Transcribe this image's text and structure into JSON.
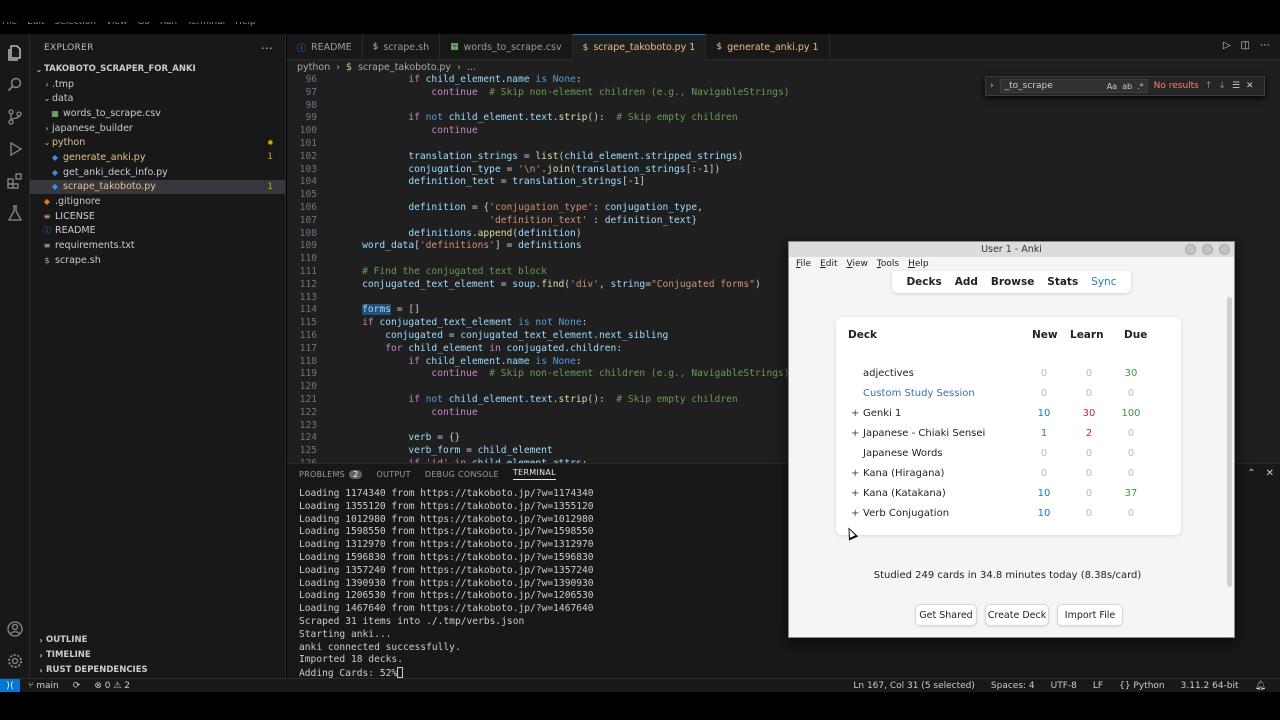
{
  "menubar": [
    "File",
    "Edit",
    "Selection",
    "View",
    "Go",
    "Run",
    "Terminal",
    "Help"
  ],
  "explorer": {
    "title": "EXPLORER",
    "root": "TAKOBOTO_SCRAPER_FOR_ANKI",
    "items": [
      {
        "label": ".tmp",
        "type": "folder",
        "indent": 1,
        "open": false
      },
      {
        "label": "data",
        "type": "folder",
        "indent": 1,
        "open": true
      },
      {
        "label": "words_to_scrape.csv",
        "type": "csv",
        "indent": 2
      },
      {
        "label": "japanese_builder",
        "type": "folder",
        "indent": 1,
        "open": false
      },
      {
        "label": "python",
        "type": "folder",
        "indent": 1,
        "open": true,
        "modified": true
      },
      {
        "label": "generate_anki.py",
        "type": "py",
        "indent": 2,
        "badge": "1",
        "modified": true
      },
      {
        "label": "get_anki_deck_info.py",
        "type": "py",
        "indent": 2
      },
      {
        "label": "scrape_takoboto.py",
        "type": "py",
        "indent": 2,
        "badge": "1",
        "modified": true,
        "selected": true
      },
      {
        "label": ".gitignore",
        "type": "git",
        "indent": 1
      },
      {
        "label": "LICENSE",
        "type": "license",
        "indent": 1
      },
      {
        "label": "README",
        "type": "info",
        "indent": 1
      },
      {
        "label": "requirements.txt",
        "type": "txt",
        "indent": 1
      },
      {
        "label": "scrape.sh",
        "type": "sh",
        "indent": 1
      }
    ],
    "sections": [
      "OUTLINE",
      "TIMELINE",
      "RUST DEPENDENCIES"
    ]
  },
  "tabs": [
    {
      "label": "README",
      "icon": "info-icon"
    },
    {
      "label": "scrape.sh",
      "icon": "dollar-icon"
    },
    {
      "label": "words_to_scrape.csv",
      "icon": "table-icon"
    },
    {
      "label": "scrape_takoboto.py 1",
      "icon": "python-icon",
      "active": true
    },
    {
      "label": "generate_anki.py 1",
      "icon": "python-icon"
    }
  ],
  "breadcrumb": [
    "python",
    "scrape_takoboto.py",
    "..."
  ],
  "find": {
    "value": "_to_scrape",
    "result": "No results"
  },
  "code_lines": [
    {
      "n": "96",
      "html": "            <span class='kc'>if</span> <span class='v'>child_element</span>.<span class='v'>name</span> <span class='k'>is</span> <span class='k'>None</span>:"
    },
    {
      "n": "97",
      "html": "                <span class='kc'>continue</span>  <span class='c'># Skip non-element children (e.g., NavigableStrings)</span>"
    },
    {
      "n": "98",
      "html": ""
    },
    {
      "n": "99",
      "html": "            <span class='kc'>if</span> <span class='k'>not</span> <span class='v'>child_element</span>.<span class='v'>text</span>.<span class='f'>strip</span>():  <span class='c'># Skip empty children</span>"
    },
    {
      "n": "100",
      "html": "                <span class='kc'>continue</span>"
    },
    {
      "n": "101",
      "html": ""
    },
    {
      "n": "102",
      "html": "            <span class='v'>translation_strings</span> = <span class='f'>list</span>(<span class='v'>child_element</span>.<span class='v'>stripped_strings</span>)"
    },
    {
      "n": "103",
      "html": "            <span class='v'>conjugation_type</span> = <span class='s'>'\\n'</span>.<span class='f'>join</span>(<span class='v'>translation_strings</span>[:-1])"
    },
    {
      "n": "104",
      "html": "            <span class='v'>definition_text</span> = <span class='v'>translation_strings</span>[-1]"
    },
    {
      "n": "105",
      "html": ""
    },
    {
      "n": "106",
      "html": "            <span class='v'>definition</span> = {<span class='s'>'conjugation_type'</span>: <span class='v'>conjugation_type</span>,"
    },
    {
      "n": "107",
      "html": "                          <span class='s'>'definition_text'</span> : <span class='v'>definition_text</span>}"
    },
    {
      "n": "108",
      "html": "            <span class='v'>definitions</span>.<span class='f'>append</span>(<span class='v'>definition</span>)"
    },
    {
      "n": "109",
      "html": "    <span class='v'>word_data</span>[<span class='s'>'definitions'</span>] = <span class='v'>definitions</span>"
    },
    {
      "n": "110",
      "html": ""
    },
    {
      "n": "111",
      "html": "    <span class='c'># Find the conjugated text block</span>"
    },
    {
      "n": "112",
      "html": "    <span class='v'>conjugated_text_element</span> = <span class='v'>soup</span>.<span class='f'>find</span>(<span class='s'>'div'</span>, <span class='v'>string</span>=<span class='s'>\"Conjugated forms\"</span>)"
    },
    {
      "n": "113",
      "html": ""
    },
    {
      "n": "114",
      "html": "    <span class='v hl'>forms</span> = []"
    },
    {
      "n": "115",
      "html": "    <span class='kc'>if</span> <span class='v'>conjugated_text_element</span> <span class='k'>is not</span> <span class='k'>None</span>:"
    },
    {
      "n": "116",
      "html": "        <span class='v'>conjugated</span> = <span class='v'>conjugated_text_element</span>.<span class='v'>next_sibling</span>"
    },
    {
      "n": "117",
      "html": "        <span class='kc'>for</span> <span class='v'>child_element</span> <span class='kc'>in</span> <span class='v'>conjugated</span>.<span class='v'>children</span>:"
    },
    {
      "n": "118",
      "html": "            <span class='kc'>if</span> <span class='v'>child_element</span>.<span class='v'>name</span> <span class='k'>is</span> <span class='k'>None</span>:"
    },
    {
      "n": "119",
      "html": "                <span class='kc'>continue</span>  <span class='c'># Skip non-element children (e.g., NavigableStrings)</span>"
    },
    {
      "n": "120",
      "html": ""
    },
    {
      "n": "121",
      "html": "            <span class='kc'>if</span> <span class='k'>not</span> <span class='v'>child_element</span>.<span class='v'>text</span>.<span class='f'>strip</span>():  <span class='c'># Skip empty children</span>"
    },
    {
      "n": "122",
      "html": "                <span class='kc'>continue</span>"
    },
    {
      "n": "123",
      "html": ""
    },
    {
      "n": "124",
      "html": "            <span class='v'>verb</span> = {}"
    },
    {
      "n": "125",
      "html": "            <span class='v'>verb_form</span> = <span class='v'>child_element</span>"
    },
    {
      "n": "126",
      "html": "            <span class='kc'>if</span> <span class='s'>'id'</span> <span class='kc'>in</span> <span class='v'>child_element</span>.<span class='v'>attrs</span>:"
    }
  ],
  "panel": {
    "tabs": [
      "PROBLEMS",
      "OUTPUT",
      "DEBUG CONSOLE",
      "TERMINAL"
    ],
    "problems_count": "2",
    "terminal": [
      "Loading 1174340 from https://takoboto.jp/?w=1174340",
      "Loading 1355120 from https://takoboto.jp/?w=1355120",
      "Loading 1012980 from https://takoboto.jp/?w=1012980",
      "Loading 1598550 from https://takoboto.jp/?w=1598550",
      "Loading 1312970 from https://takoboto.jp/?w=1312970",
      "Loading 1596830 from https://takoboto.jp/?w=1596830",
      "Loading 1357240 from https://takoboto.jp/?w=1357240",
      "Loading 1390930 from https://takoboto.jp/?w=1390930",
      "Loading 1206530 from https://takoboto.jp/?w=1206530",
      "Loading 1467640 from https://takoboto.jp/?w=1467640",
      "Scraped 31 items into ./.tmp/verbs.json",
      "Starting anki...",
      "anki connected successfully.",
      "Imported 18 decks.",
      "Adding Cards: 52%"
    ]
  },
  "status": {
    "branch": "main",
    "errors": "0",
    "warnings": "2",
    "position": "Ln 167, Col 31 (5 selected)",
    "spaces": "Spaces: 4",
    "encoding": "UTF-8",
    "eol": "LF",
    "language": "Python",
    "interpreter": "3.11.2 64-bit"
  },
  "anki": {
    "title": "User 1 - Anki",
    "menu": [
      "File",
      "Edit",
      "View",
      "Tools",
      "Help"
    ],
    "toolbar": [
      "Decks",
      "Add",
      "Browse",
      "Stats",
      "Sync"
    ],
    "headers": {
      "deck": "Deck",
      "new": "New",
      "learn": "Learn",
      "due": "Due"
    },
    "decks": [
      {
        "name": "adjectives",
        "expand": "",
        "new": "0",
        "learn": "0",
        "due": "30",
        "new_c": "zero",
        "learn_c": "zero",
        "due_c": "green",
        "name_c": ""
      },
      {
        "name": "Custom Study Session",
        "expand": "",
        "new": "0",
        "learn": "0",
        "due": "0",
        "new_c": "zero",
        "learn_c": "zero",
        "due_c": "zero",
        "name_c": "link"
      },
      {
        "name": "Genki 1",
        "expand": "+",
        "new": "10",
        "learn": "30",
        "due": "100",
        "new_c": "blue",
        "learn_c": "red",
        "due_c": "green",
        "name_c": ""
      },
      {
        "name": "Japanese - Chiaki Sensei",
        "expand": "+",
        "new": "1",
        "learn": "2",
        "due": "0",
        "new_c": "blue",
        "learn_c": "red",
        "due_c": "zero",
        "name_c": ""
      },
      {
        "name": "Japanese Words",
        "expand": "",
        "new": "0",
        "learn": "0",
        "due": "0",
        "new_c": "zero",
        "learn_c": "zero",
        "due_c": "zero",
        "name_c": ""
      },
      {
        "name": "Kana (Hiragana)",
        "expand": "+",
        "new": "0",
        "learn": "0",
        "due": "0",
        "new_c": "zero",
        "learn_c": "zero",
        "due_c": "zero",
        "name_c": ""
      },
      {
        "name": "Kana (Katakana)",
        "expand": "+",
        "new": "10",
        "learn": "0",
        "due": "37",
        "new_c": "blue",
        "learn_c": "zero",
        "due_c": "green",
        "name_c": ""
      },
      {
        "name": "Verb Conjugation",
        "expand": "+",
        "new": "10",
        "learn": "0",
        "due": "0",
        "new_c": "blue",
        "learn_c": "zero",
        "due_c": "zero",
        "name_c": ""
      }
    ],
    "studied": "Studied 249 cards in 34.8 minutes today (8.38s/card)",
    "buttons": [
      "Get Shared",
      "Create Deck",
      "Import File"
    ]
  }
}
